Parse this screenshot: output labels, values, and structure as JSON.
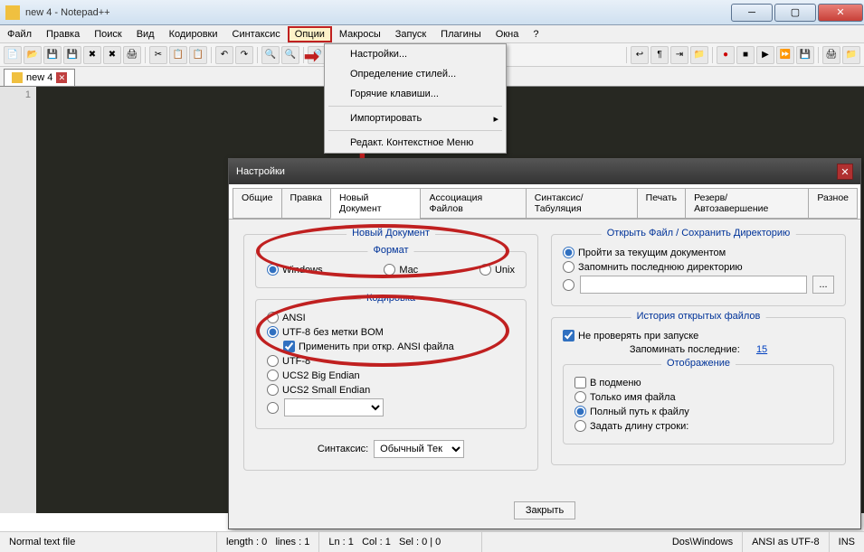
{
  "window": {
    "title": "new  4 - Notepad++"
  },
  "menubar": [
    "Файл",
    "Правка",
    "Поиск",
    "Вид",
    "Кодировки",
    "Синтаксис",
    "Опции",
    "Макросы",
    "Запуск",
    "Плагины",
    "Окна",
    "?"
  ],
  "active_menu_index": 6,
  "dropdown": {
    "items": [
      "Настройки...",
      "Определение стилей...",
      "Горячие клавиши...",
      "-",
      "Импортировать",
      "-",
      "Редакт. Контекстное Меню"
    ]
  },
  "tab": {
    "name": "new  4"
  },
  "gutter_line": "1",
  "dialog": {
    "title": "Настройки",
    "tabs": [
      "Общие",
      "Правка",
      "Новый Документ",
      "Ассоциация Файлов",
      "Синтаксис/Табуляция",
      "Печать",
      "Резерв/Автозавершение",
      "Разное"
    ],
    "active_tab": 2,
    "newdoc": {
      "legend": "Новый Документ",
      "fmt_legend": "Формат",
      "fmt_opts": [
        "Windows",
        "Mac",
        "Unix"
      ],
      "enc_legend": "Кодировка",
      "enc_opts": [
        "ANSI",
        "UTF-8 без метки BOM",
        "UTF-8",
        "UCS2 Big Endian",
        "UCS2 Small Endian"
      ],
      "apply_ansi": "Применить при откр. ANSI файла",
      "syntax_label": "Синтаксис:",
      "syntax_value": "Обычный Тек"
    },
    "openfile": {
      "legend": "Открыть Файл / Сохранить Директорию",
      "opt1": "Пройти за текущим документом",
      "opt2": "Запомнить последнюю директорию",
      "dotbtn": "..."
    },
    "history": {
      "legend": "История открытых файлов",
      "nochk": "Не проверять при запуске",
      "remember": "Запоминать последние:",
      "remember_n": "15",
      "display_legend": "Отображение",
      "submenu": "В подменю",
      "nameonly": "Только имя файла",
      "fullpath": "Полный путь к файлу",
      "setlen": "Задать длину строки:"
    },
    "close": "Закрыть"
  },
  "status": {
    "mode": "Normal text file",
    "length": "length : 0",
    "lines": "lines : 1",
    "ln": "Ln : 1",
    "col": "Col : 1",
    "sel": "Sel : 0 | 0",
    "os": "Dos\\Windows",
    "enc": "ANSI as UTF-8",
    "ins": "INS"
  }
}
